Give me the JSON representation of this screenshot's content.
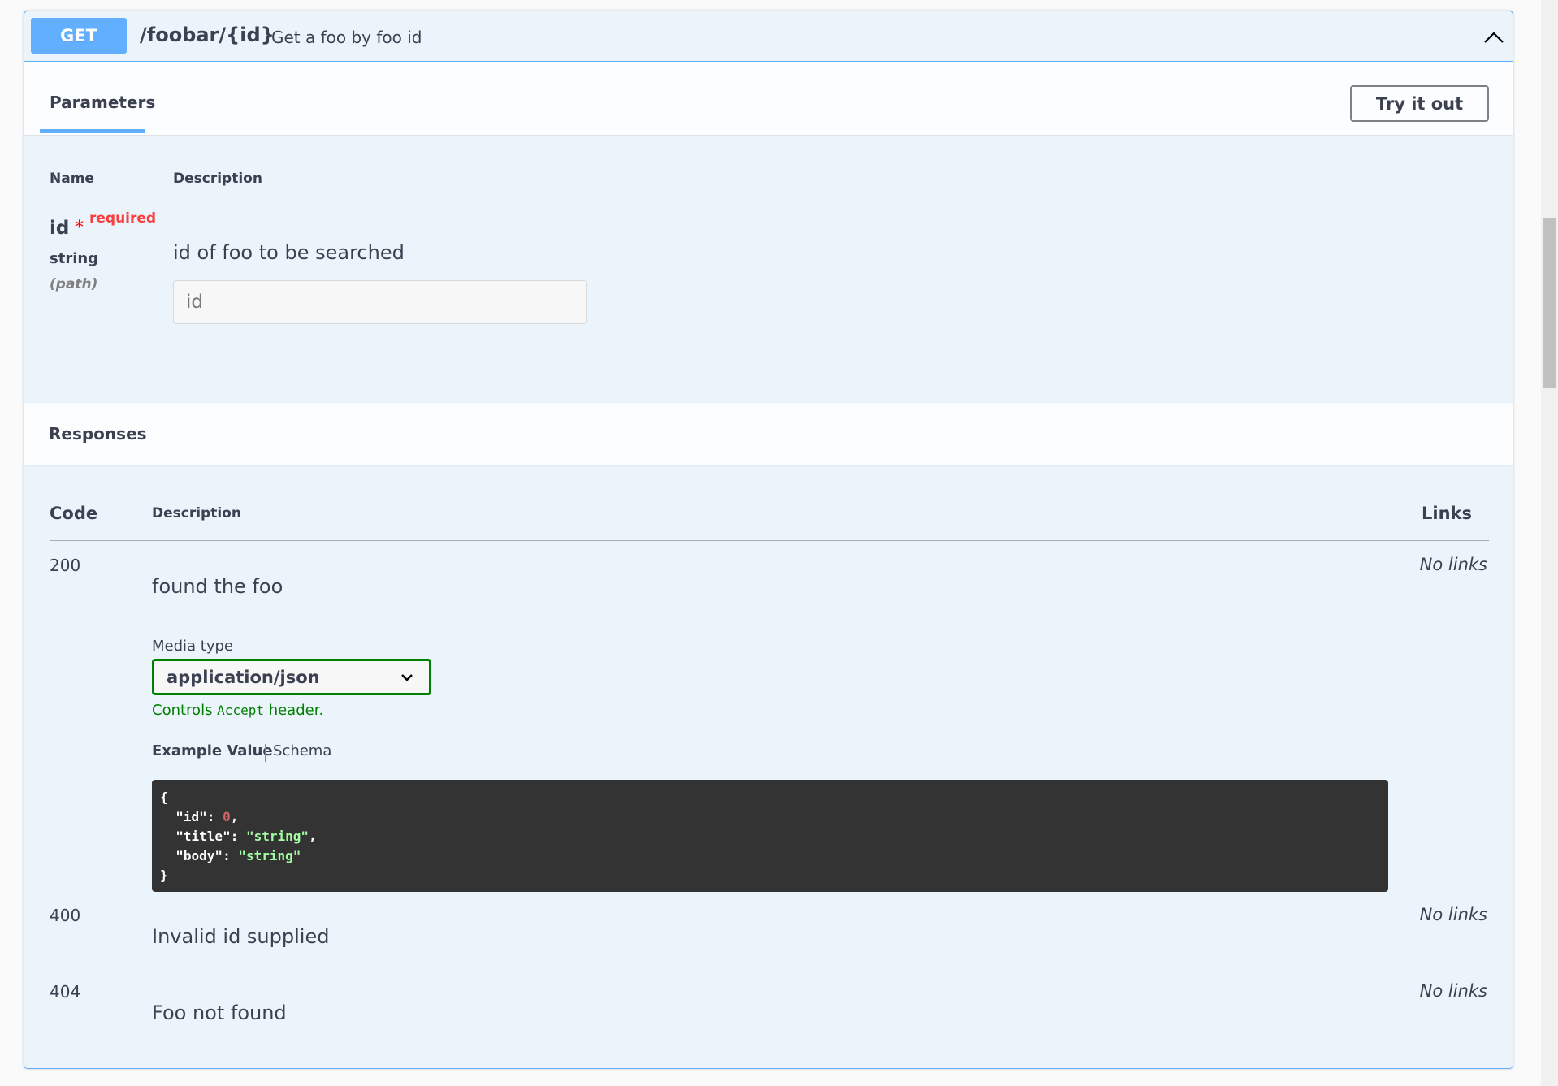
{
  "operation": {
    "method": "GET",
    "path": "/foobar/{id}",
    "summary": "Get a foo by foo id"
  },
  "parameters_section": {
    "tab_label": "Parameters",
    "try_button": "Try it out",
    "col_name": "Name",
    "col_description": "Description",
    "param": {
      "name": "id",
      "star": "*",
      "required_label": "required",
      "type": "string",
      "in": "(path)",
      "description": "id of foo to be searched",
      "placeholder": "id",
      "value": ""
    }
  },
  "responses_section": {
    "title": "Responses",
    "col_code": "Code",
    "col_description": "Description",
    "col_links": "Links",
    "media_type_label": "Media type",
    "media_type_value": "application/json",
    "controls_prefix": "Controls ",
    "controls_code": "Accept",
    "controls_suffix": " header.",
    "example_tab": "Example Value",
    "schema_tab": "Schema",
    "example_json": {
      "open": "{",
      "id_key": "  \"id\"",
      "id_val": "0",
      "title_key": "  \"title\"",
      "title_val": "\"string\"",
      "body_key": "  \"body\"",
      "body_val": "\"string\"",
      "close": "}"
    },
    "responses": [
      {
        "code": "200",
        "description": "found the foo",
        "links": "No links"
      },
      {
        "code": "400",
        "description": "Invalid id supplied",
        "links": "No links"
      },
      {
        "code": "404",
        "description": "Foo not found",
        "links": "No links"
      }
    ]
  },
  "colors": {
    "get_accent": "#61affe",
    "background": "#ebf3fb",
    "required": "#f93e3e",
    "media_border": "#008000",
    "code_bg": "#333333"
  },
  "icons": {
    "collapse": "chevron-up-icon",
    "select": "chevron-down-icon"
  }
}
